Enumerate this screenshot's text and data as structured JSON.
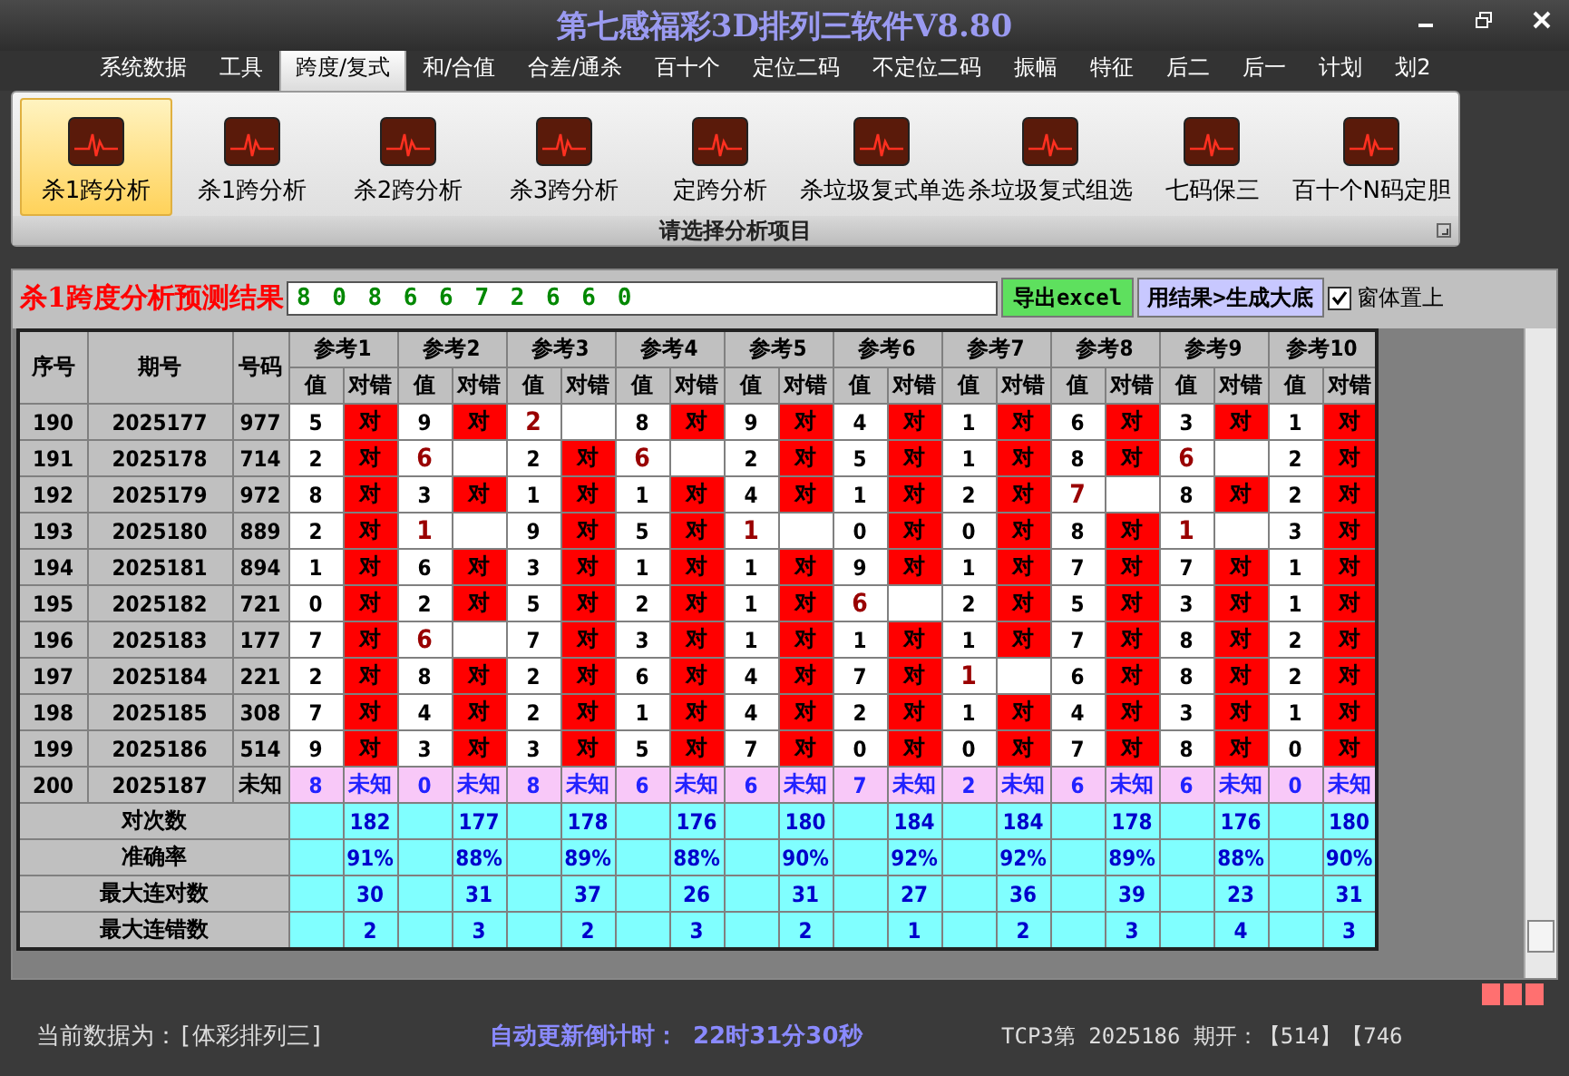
{
  "window": {
    "title": "第七感福彩3D排列三软件V8.80"
  },
  "menu": [
    {
      "label": "系统数据",
      "selected": false
    },
    {
      "label": "工具",
      "selected": false
    },
    {
      "label": "跨度/复式",
      "selected": true
    },
    {
      "label": "和/合值",
      "selected": false
    },
    {
      "label": "合差/通杀",
      "selected": false
    },
    {
      "label": "百十个",
      "selected": false
    },
    {
      "label": "定位二码",
      "selected": false
    },
    {
      "label": "不定位二码",
      "selected": false
    },
    {
      "label": "振幅",
      "selected": false
    },
    {
      "label": "特征",
      "selected": false
    },
    {
      "label": "后二",
      "selected": false
    },
    {
      "label": "后一",
      "selected": false
    },
    {
      "label": "计划",
      "selected": false
    },
    {
      "label": "划2",
      "selected": false
    }
  ],
  "ribbon": {
    "caption": "请选择分析项目",
    "items": [
      {
        "label": "杀1跨分析",
        "selected": true
      },
      {
        "label": "杀1跨分析",
        "selected": false
      },
      {
        "label": "杀2跨分析",
        "selected": false
      },
      {
        "label": "杀3跨分析",
        "selected": false
      },
      {
        "label": "定跨分析",
        "selected": false
      },
      {
        "label": "杀垃圾复式单选",
        "selected": false
      },
      {
        "label": "杀垃圾复式组选",
        "selected": false
      },
      {
        "label": "七码保三",
        "selected": false
      },
      {
        "label": "百十个N码定胆",
        "selected": false
      }
    ]
  },
  "result_bar": {
    "title": "杀1跨度分析预测结果",
    "value": "8 0 8 6 6 7 2 6 6 0",
    "export_button": "导出excel",
    "generate_button": "用结果>生成大底",
    "pin": {
      "label": "窗体置上",
      "checked": true
    }
  },
  "table": {
    "columns": [
      "序号",
      "期号",
      "号码"
    ],
    "groups": [
      {
        "label": "参考1",
        "sub_columns": [
          "值",
          "对错"
        ]
      },
      {
        "label": "参考2",
        "sub_columns": [
          "值",
          "对错"
        ]
      },
      {
        "label": "参考3",
        "sub_columns": [
          "值",
          "对错"
        ]
      },
      {
        "label": "参考4",
        "sub_columns": [
          "值",
          "对错"
        ]
      },
      {
        "label": "参考5",
        "sub_columns": [
          "值",
          "对错"
        ]
      },
      {
        "label": "参考6",
        "sub_columns": [
          "值",
          "对错"
        ]
      },
      {
        "label": "参考7",
        "sub_columns": [
          "值",
          "对错"
        ]
      },
      {
        "label": "参考8",
        "sub_columns": [
          "值",
          "对错"
        ]
      },
      {
        "label": "参考9",
        "sub_columns": [
          "值",
          "对错"
        ]
      },
      {
        "label": "参考10",
        "sub_columns": [
          "值",
          "对错"
        ]
      }
    ],
    "rows": [
      {
        "kind": "done",
        "seq": "190",
        "period": "2025177",
        "number": "977",
        "cells": [
          {
            "value": "5",
            "result": "对",
            "hit": true
          },
          {
            "value": "9",
            "result": "对",
            "hit": true
          },
          {
            "value": "2",
            "hit": false
          },
          {
            "value": "8",
            "result": "对",
            "hit": true
          },
          {
            "value": "9",
            "result": "对",
            "hit": true
          },
          {
            "value": "4",
            "result": "对",
            "hit": true
          },
          {
            "value": "1",
            "result": "对",
            "hit": true
          },
          {
            "value": "6",
            "result": "对",
            "hit": true
          },
          {
            "value": "3",
            "result": "对",
            "hit": true
          },
          {
            "value": "1",
            "result": "对",
            "hit": true
          }
        ]
      },
      {
        "kind": "done",
        "seq": "191",
        "period": "2025178",
        "number": "714",
        "cells": [
          {
            "value": "2",
            "result": "对",
            "hit": true
          },
          {
            "value": "6",
            "hit": false
          },
          {
            "value": "2",
            "result": "对",
            "hit": true
          },
          {
            "value": "6",
            "hit": false
          },
          {
            "value": "2",
            "result": "对",
            "hit": true
          },
          {
            "value": "5",
            "result": "对",
            "hit": true
          },
          {
            "value": "1",
            "result": "对",
            "hit": true
          },
          {
            "value": "8",
            "result": "对",
            "hit": true
          },
          {
            "value": "6",
            "hit": false
          },
          {
            "value": "2",
            "result": "对",
            "hit": true
          }
        ]
      },
      {
        "kind": "done",
        "seq": "192",
        "period": "2025179",
        "number": "972",
        "cells": [
          {
            "value": "8",
            "result": "对",
            "hit": true
          },
          {
            "value": "3",
            "result": "对",
            "hit": true
          },
          {
            "value": "1",
            "result": "对",
            "hit": true
          },
          {
            "value": "1",
            "result": "对",
            "hit": true
          },
          {
            "value": "4",
            "result": "对",
            "hit": true
          },
          {
            "value": "1",
            "result": "对",
            "hit": true
          },
          {
            "value": "2",
            "result": "对",
            "hit": true
          },
          {
            "value": "7",
            "hit": false
          },
          {
            "value": "8",
            "result": "对",
            "hit": true
          },
          {
            "value": "2",
            "result": "对",
            "hit": true
          }
        ]
      },
      {
        "kind": "done",
        "seq": "193",
        "period": "2025180",
        "number": "889",
        "cells": [
          {
            "value": "2",
            "result": "对",
            "hit": true
          },
          {
            "value": "1",
            "hit": false
          },
          {
            "value": "9",
            "result": "对",
            "hit": true
          },
          {
            "value": "5",
            "result": "对",
            "hit": true
          },
          {
            "value": "1",
            "hit": false
          },
          {
            "value": "0",
            "result": "对",
            "hit": true
          },
          {
            "value": "0",
            "result": "对",
            "hit": true
          },
          {
            "value": "8",
            "result": "对",
            "hit": true
          },
          {
            "value": "1",
            "hit": false
          },
          {
            "value": "3",
            "result": "对",
            "hit": true
          }
        ]
      },
      {
        "kind": "done",
        "seq": "194",
        "period": "2025181",
        "number": "894",
        "cells": [
          {
            "value": "1",
            "result": "对",
            "hit": true
          },
          {
            "value": "6",
            "result": "对",
            "hit": true
          },
          {
            "value": "3",
            "result": "对",
            "hit": true
          },
          {
            "value": "1",
            "result": "对",
            "hit": true
          },
          {
            "value": "1",
            "result": "对",
            "hit": true
          },
          {
            "value": "9",
            "result": "对",
            "hit": true
          },
          {
            "value": "1",
            "result": "对",
            "hit": true
          },
          {
            "value": "7",
            "result": "对",
            "hit": true
          },
          {
            "value": "7",
            "result": "对",
            "hit": true
          },
          {
            "value": "1",
            "result": "对",
            "hit": true
          }
        ]
      },
      {
        "kind": "done",
        "seq": "195",
        "period": "2025182",
        "number": "721",
        "cells": [
          {
            "value": "0",
            "result": "对",
            "hit": true
          },
          {
            "value": "2",
            "result": "对",
            "hit": true
          },
          {
            "value": "5",
            "result": "对",
            "hit": true
          },
          {
            "value": "2",
            "result": "对",
            "hit": true
          },
          {
            "value": "1",
            "result": "对",
            "hit": true
          },
          {
            "value": "6",
            "hit": false
          },
          {
            "value": "2",
            "result": "对",
            "hit": true
          },
          {
            "value": "5",
            "result": "对",
            "hit": true
          },
          {
            "value": "3",
            "result": "对",
            "hit": true
          },
          {
            "value": "1",
            "result": "对",
            "hit": true
          }
        ]
      },
      {
        "kind": "done",
        "seq": "196",
        "period": "2025183",
        "number": "177",
        "cells": [
          {
            "value": "7",
            "result": "对",
            "hit": true
          },
          {
            "value": "6",
            "hit": false
          },
          {
            "value": "7",
            "result": "对",
            "hit": true
          },
          {
            "value": "3",
            "result": "对",
            "hit": true
          },
          {
            "value": "1",
            "result": "对",
            "hit": true
          },
          {
            "value": "1",
            "result": "对",
            "hit": true
          },
          {
            "value": "1",
            "result": "对",
            "hit": true
          },
          {
            "value": "7",
            "result": "对",
            "hit": true
          },
          {
            "value": "8",
            "result": "对",
            "hit": true
          },
          {
            "value": "2",
            "result": "对",
            "hit": true
          }
        ]
      },
      {
        "kind": "done",
        "seq": "197",
        "period": "2025184",
        "number": "221",
        "cells": [
          {
            "value": "2",
            "result": "对",
            "hit": true
          },
          {
            "value": "8",
            "result": "对",
            "hit": true
          },
          {
            "value": "2",
            "result": "对",
            "hit": true
          },
          {
            "value": "6",
            "result": "对",
            "hit": true
          },
          {
            "value": "4",
            "result": "对",
            "hit": true
          },
          {
            "value": "7",
            "result": "对",
            "hit": true
          },
          {
            "value": "1",
            "hit": false
          },
          {
            "value": "6",
            "result": "对",
            "hit": true
          },
          {
            "value": "8",
            "result": "对",
            "hit": true
          },
          {
            "value": "2",
            "result": "对",
            "hit": true
          }
        ]
      },
      {
        "kind": "done",
        "seq": "198",
        "period": "2025185",
        "number": "308",
        "cells": [
          {
            "value": "7",
            "result": "对",
            "hit": true
          },
          {
            "value": "4",
            "result": "对",
            "hit": true
          },
          {
            "value": "2",
            "result": "对",
            "hit": true
          },
          {
            "value": "1",
            "result": "对",
            "hit": true
          },
          {
            "value": "4",
            "result": "对",
            "hit": true
          },
          {
            "value": "2",
            "result": "对",
            "hit": true
          },
          {
            "value": "1",
            "result": "对",
            "hit": true
          },
          {
            "value": "4",
            "result": "对",
            "hit": true
          },
          {
            "value": "3",
            "result": "对",
            "hit": true
          },
          {
            "value": "1",
            "result": "对",
            "hit": true
          }
        ]
      },
      {
        "kind": "done",
        "seq": "199",
        "period": "2025186",
        "number": "514",
        "cells": [
          {
            "value": "9",
            "result": "对",
            "hit": true
          },
          {
            "value": "3",
            "result": "对",
            "hit": true
          },
          {
            "value": "3",
            "result": "对",
            "hit": true
          },
          {
            "value": "5",
            "result": "对",
            "hit": true
          },
          {
            "value": "7",
            "result": "对",
            "hit": true
          },
          {
            "value": "0",
            "result": "对",
            "hit": true
          },
          {
            "value": "0",
            "result": "对",
            "hit": true
          },
          {
            "value": "7",
            "result": "对",
            "hit": true
          },
          {
            "value": "8",
            "result": "对",
            "hit": true
          },
          {
            "value": "0",
            "result": "对",
            "hit": true
          }
        ]
      },
      {
        "kind": "pending",
        "seq": "200",
        "period": "2025187",
        "number": "未知",
        "cells": [
          {
            "value": "8",
            "result": "未知"
          },
          {
            "value": "0",
            "result": "未知"
          },
          {
            "value": "8",
            "result": "未知"
          },
          {
            "value": "6",
            "result": "未知"
          },
          {
            "value": "6",
            "result": "未知"
          },
          {
            "value": "7",
            "result": "未知"
          },
          {
            "value": "2",
            "result": "未知"
          },
          {
            "value": "6",
            "result": "未知"
          },
          {
            "value": "6",
            "result": "未知"
          },
          {
            "value": "0",
            "result": "未知"
          }
        ]
      }
    ],
    "summary": [
      {
        "label": "对次数",
        "values": [
          "182",
          "177",
          "178",
          "176",
          "180",
          "184",
          "184",
          "178",
          "176",
          "180"
        ]
      },
      {
        "label": "准确率",
        "values": [
          "91%",
          "88%",
          "89%",
          "88%",
          "90%",
          "92%",
          "92%",
          "89%",
          "88%",
          "90%"
        ]
      },
      {
        "label": "最大连对数",
        "values": [
          "30",
          "31",
          "37",
          "26",
          "31",
          "27",
          "36",
          "39",
          "23",
          "31"
        ]
      },
      {
        "label": "最大连错数",
        "values": [
          "2",
          "3",
          "2",
          "3",
          "2",
          "1",
          "2",
          "3",
          "4",
          "3"
        ]
      }
    ]
  },
  "status_bar": {
    "source": "当前数据为：[体彩排列三]",
    "countdown_label": "自动更新倒计时：",
    "countdown": "22时31分30秒",
    "draw_info": "TCP3第 2025186 期开：【514】【746"
  }
}
